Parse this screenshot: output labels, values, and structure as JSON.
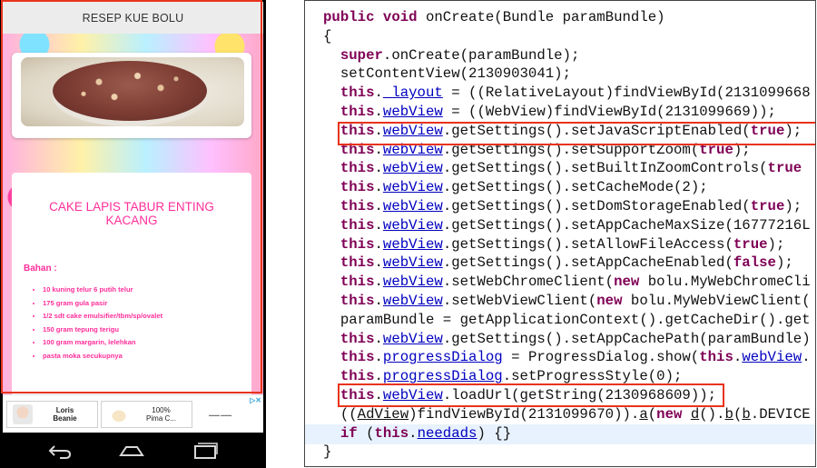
{
  "phone": {
    "app_title": "RESEP KUE BOLU",
    "recipe_title": "CAKE LAPIS TABUR ENTING KACANG",
    "bahan_label": "Bahan :",
    "ingredients": [
      "10 kuning telur 6 putih telur",
      "175 gram gula pasir",
      "1/2 sdt cake emulsifier/tbm/sp/ovalet",
      "150 gram tepung terigu",
      "100 gram margarin, lelehkan",
      "pasta moka secukupnya"
    ],
    "ads": {
      "ad1_text_line1": "Loris",
      "ad1_text_line2": "Beanie",
      "ad2_text_line1": "100%",
      "ad2_text_line2": "Pima C...",
      "adchoices": "▷✕"
    },
    "nav_icons": [
      "back-icon",
      "home-icon",
      "recent-apps-icon"
    ],
    "highlight_color": "#e8331c"
  },
  "code": {
    "lines": [
      "public void onCreate(Bundle paramBundle)",
      "{",
      "  super.onCreate(paramBundle);",
      "  setContentView(2130903041);",
      "  this._layout = ((RelativeLayout)findViewById(2131099668",
      "  this.webView = ((WebView)findViewById(2131099669));",
      "  this.webView.getSettings().setJavaScriptEnabled(true);",
      "  this.webView.getSettings().setSupportZoom(true);",
      "  this.webView.getSettings().setBuiltInZoomControls(true",
      "  this.webView.getSettings().setCacheMode(2);",
      "  this.webView.getSettings().setDomStorageEnabled(true);",
      "  this.webView.getSettings().setAppCacheMaxSize(16777216L",
      "  this.webView.getSettings().setAllowFileAccess(true);",
      "  this.webView.getSettings().setAppCacheEnabled(false);",
      "  this.webView.setWebChromeClient(new bolu.MyWebChromeCli",
      "  this.webView.setWebViewClient(new bolu.MyWebViewClient(",
      "  paramBundle = getApplicationContext().getCacheDir().get",
      "  this.webView.getSettings().setAppCachePath(paramBundle)",
      "  this.progressDialog = ProgressDialog.show(this.webView.",
      "  this.progressDialog.setProgressStyle(0);",
      "  this.webView.loadUrl(getString(2130968609));",
      "  ((AdView)findViewById(2131099670)).a(new d().b(b.DEVICE",
      "  if (this.needads) {}",
      "}"
    ],
    "highlighted_line_indices": [
      6,
      20
    ],
    "current_line_index": 22,
    "keyword_color": "#7f0055",
    "field_color": "#0000c0",
    "current_line_color": "#e8f2fe"
  }
}
